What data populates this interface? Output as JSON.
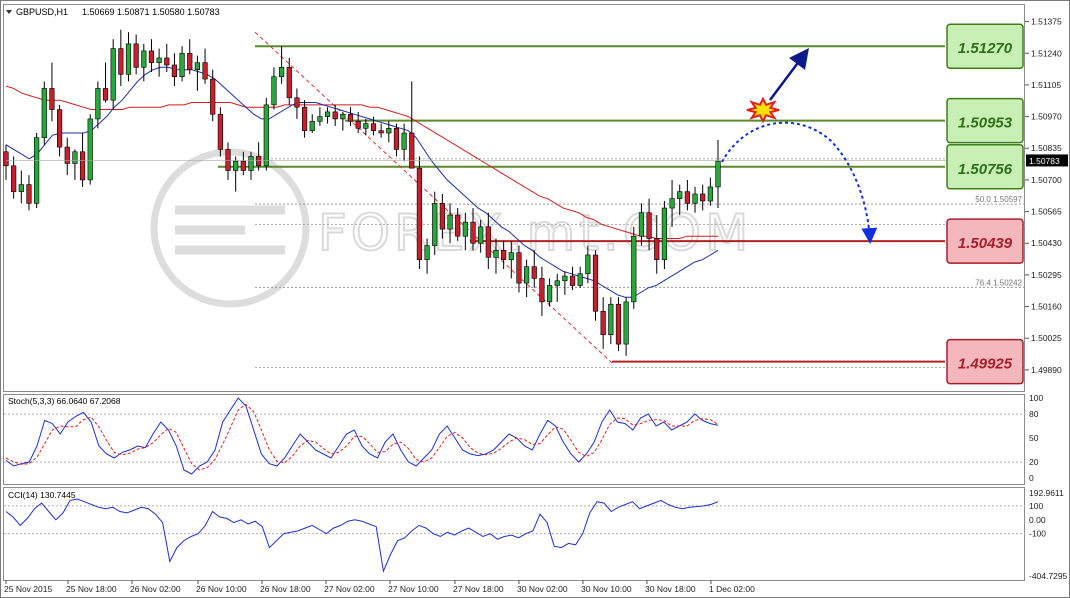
{
  "chart_data": [
    {
      "type": "candlestick",
      "symbol_label": "GBPUSD,H1",
      "ohlc_label": "1.50669 1.50871 1.50580 1.50783",
      "current_price": "1.50783",
      "ylim": [
        1.498,
        1.5145
      ],
      "price_ticks": [
        "1.51375",
        "1.51240",
        "1.51105",
        "1.50970",
        "1.50835",
        "1.50700",
        "1.50565",
        "1.50430",
        "1.50295",
        "1.50160",
        "1.50025",
        "1.49890"
      ],
      "time_ticks": [
        "25 Nov 2015",
        "25 Nov 18:00",
        "26 Nov 02:00",
        "26 Nov 10:00",
        "26 Nov 18:00",
        "27 Nov 02:00",
        "27 Nov 10:00",
        "27 Nov 18:00",
        "30 Nov 02:00",
        "30 Nov 10:00",
        "30 Nov 18:00",
        "1 Dec 02:00"
      ],
      "candles": [
        [
          1.5082,
          1.5085,
          1.507,
          1.5076
        ],
        [
          1.5076,
          1.508,
          1.5062,
          1.5065
        ],
        [
          1.5065,
          1.5074,
          1.506,
          1.5068
        ],
        [
          1.5068,
          1.5072,
          1.5057,
          1.506
        ],
        [
          1.506,
          1.509,
          1.5058,
          1.5088
        ],
        [
          1.5088,
          1.5112,
          1.5085,
          1.5109
        ],
        [
          1.5109,
          1.512,
          1.5095,
          1.51
        ],
        [
          1.51,
          1.5102,
          1.508,
          1.5084
        ],
        [
          1.5084,
          1.5088,
          1.5072,
          1.5077
        ],
        [
          1.5077,
          1.5083,
          1.507,
          1.5082
        ],
        [
          1.5082,
          1.509,
          1.5067,
          1.507
        ],
        [
          1.507,
          1.5098,
          1.5068,
          1.5096
        ],
        [
          1.5096,
          1.5112,
          1.5092,
          1.5109
        ],
        [
          1.5109,
          1.512,
          1.5103,
          1.5104
        ],
        [
          1.5104,
          1.513,
          1.51,
          1.5126
        ],
        [
          1.5126,
          1.5134,
          1.511,
          1.5115
        ],
        [
          1.5115,
          1.5133,
          1.5112,
          1.5128
        ],
        [
          1.5128,
          1.5132,
          1.5115,
          1.5118
        ],
        [
          1.5118,
          1.5128,
          1.5112,
          1.5125
        ],
        [
          1.5125,
          1.513,
          1.5116,
          1.512
        ],
        [
          1.512,
          1.5126,
          1.5114,
          1.5122
        ],
        [
          1.5122,
          1.5128,
          1.5116,
          1.5119
        ],
        [
          1.5119,
          1.5124,
          1.511,
          1.5114
        ],
        [
          1.5114,
          1.5127,
          1.5112,
          1.5124
        ],
        [
          1.5124,
          1.513,
          1.5115,
          1.5117
        ],
        [
          1.5117,
          1.5123,
          1.5108,
          1.512
        ],
        [
          1.512,
          1.5126,
          1.5111,
          1.5113
        ],
        [
          1.5113,
          1.5117,
          1.5095,
          1.5098
        ],
        [
          1.5098,
          1.5101,
          1.508,
          1.5083
        ],
        [
          1.5083,
          1.5086,
          1.507,
          1.5074
        ],
        [
          1.5074,
          1.508,
          1.5065,
          1.5078
        ],
        [
          1.5078,
          1.5082,
          1.5072,
          1.5074
        ],
        [
          1.5074,
          1.5082,
          1.507,
          1.508
        ],
        [
          1.508,
          1.5086,
          1.5074,
          1.5076
        ],
        [
          1.5076,
          1.5105,
          1.5074,
          1.5102
        ],
        [
          1.5102,
          1.5118,
          1.51,
          1.5114
        ],
        [
          1.5114,
          1.5127,
          1.5111,
          1.5118
        ],
        [
          1.5118,
          1.5122,
          1.5102,
          1.5105
        ],
        [
          1.5105,
          1.5109,
          1.5096,
          1.5101
        ],
        [
          1.5101,
          1.5104,
          1.5088,
          1.5091
        ],
        [
          1.5091,
          1.5098,
          1.509,
          1.5095
        ],
        [
          1.5095,
          1.5101,
          1.5093,
          1.5097
        ],
        [
          1.5097,
          1.5101,
          1.5094,
          1.5099
        ],
        [
          1.5099,
          1.5102,
          1.5093,
          1.5096
        ],
        [
          1.5096,
          1.5099,
          1.5091,
          1.5098
        ],
        [
          1.5098,
          1.5101,
          1.5093,
          1.5095
        ],
        [
          1.5095,
          1.5099,
          1.509,
          1.5092
        ],
        [
          1.5092,
          1.5096,
          1.5089,
          1.5094
        ],
        [
          1.5094,
          1.5097,
          1.5089,
          1.5091
        ],
        [
          1.5091,
          1.5094,
          1.5088,
          1.509
        ],
        [
          1.509,
          1.5095,
          1.5086,
          1.5092
        ],
        [
          1.5092,
          1.5094,
          1.508,
          1.5083
        ],
        [
          1.5083,
          1.5094,
          1.5078,
          1.509
        ],
        [
          1.509,
          1.5112,
          1.5076,
          1.5075
        ],
        [
          1.5075,
          1.508,
          1.5032,
          1.5036
        ],
        [
          1.5036,
          1.5045,
          1.503,
          1.5042
        ],
        [
          1.5042,
          1.5065,
          1.5038,
          1.506
        ],
        [
          1.506,
          1.5064,
          1.5045,
          1.5049
        ],
        [
          1.5049,
          1.506,
          1.5043,
          1.5055
        ],
        [
          1.5055,
          1.5058,
          1.5044,
          1.5046
        ],
        [
          1.5046,
          1.5056,
          1.504,
          1.5052
        ],
        [
          1.5052,
          1.5058,
          1.504,
          1.5043
        ],
        [
          1.5043,
          1.5053,
          1.5039,
          1.505
        ],
        [
          1.505,
          1.5056,
          1.5032,
          1.5037
        ],
        [
          1.5037,
          1.5045,
          1.503,
          1.504
        ],
        [
          1.504,
          1.5044,
          1.5032,
          1.5036
        ],
        [
          1.5036,
          1.5044,
          1.5028,
          1.5039
        ],
        [
          1.5039,
          1.5042,
          1.5022,
          1.5026
        ],
        [
          1.5026,
          1.5036,
          1.502,
          1.5033
        ],
        [
          1.5033,
          1.504,
          1.5024,
          1.5028
        ],
        [
          1.5028,
          1.5033,
          1.5012,
          1.5018
        ],
        [
          1.5018,
          1.5028,
          1.5016,
          1.5025
        ],
        [
          1.5025,
          1.503,
          1.5018,
          1.5027
        ],
        [
          1.5027,
          1.5031,
          1.5021,
          1.5029
        ],
        [
          1.5029,
          1.5033,
          1.5023,
          1.5025
        ],
        [
          1.5025,
          1.5033,
          1.5024,
          1.503
        ],
        [
          1.503,
          1.5042,
          1.5026,
          1.5038
        ],
        [
          1.5038,
          1.504,
          1.501,
          1.5014
        ],
        [
          1.5014,
          1.502,
          1.4998,
          1.5004
        ],
        [
          1.5004,
          1.502,
          1.5,
          1.5017
        ],
        [
          1.5017,
          1.502,
          1.4997,
          1.5
        ],
        [
          1.5,
          1.502,
          1.4995,
          1.5018
        ],
        [
          1.5018,
          1.505,
          1.5015,
          1.5046
        ],
        [
          1.5046,
          1.506,
          1.5042,
          1.5056
        ],
        [
          1.5056,
          1.5062,
          1.504,
          1.5045
        ],
        [
          1.5045,
          1.5055,
          1.503,
          1.5036
        ],
        [
          1.5036,
          1.5061,
          1.5032,
          1.5058
        ],
        [
          1.5058,
          1.507,
          1.505,
          1.5062
        ],
        [
          1.5062,
          1.5068,
          1.5055,
          1.5065
        ],
        [
          1.5065,
          1.507,
          1.5057,
          1.506
        ],
        [
          1.506,
          1.5067,
          1.5056,
          1.5064
        ],
        [
          1.5064,
          1.5068,
          1.5057,
          1.5061
        ],
        [
          1.5061,
          1.5071,
          1.5059,
          1.5067
        ],
        [
          1.5067,
          1.5087,
          1.5058,
          1.5078
        ]
      ],
      "ma_fast": [
        1.5085,
        1.5083,
        1.5081,
        1.5079,
        1.5081,
        1.5085,
        1.5089,
        1.509,
        1.509,
        1.509,
        1.509,
        1.5091,
        1.5094,
        1.5097,
        1.5101,
        1.5104,
        1.5108,
        1.5112,
        1.5115,
        1.5117,
        1.5118,
        1.5118,
        1.5117,
        1.5117,
        1.5117,
        1.5116,
        1.5115,
        1.5113,
        1.511,
        1.5107,
        1.5104,
        1.5101,
        1.5098,
        1.5096,
        1.5096,
        1.5098,
        1.51,
        1.5102,
        1.5103,
        1.5103,
        1.5103,
        1.5102,
        1.5101,
        1.51,
        1.5099,
        1.5098,
        1.5097,
        1.5096,
        1.5095,
        1.5094,
        1.5093,
        1.5092,
        1.5091,
        1.5088,
        1.5083,
        1.5078,
        1.5074,
        1.507,
        1.5067,
        1.5064,
        1.5061,
        1.5058,
        1.5056,
        1.5053,
        1.505,
        1.5048,
        1.5045,
        1.5042,
        1.504,
        1.5037,
        1.5035,
        1.5033,
        1.5031,
        1.503,
        1.5029,
        1.5028,
        1.5027,
        1.5025,
        1.5023,
        1.5021,
        1.502,
        1.502,
        1.5022,
        1.5024,
        1.5025,
        1.5027,
        1.5029,
        1.5031,
        1.5033,
        1.5035,
        1.5036,
        1.5038,
        1.504
      ],
      "ma_slow": [
        1.511,
        1.5109,
        1.5107,
        1.5106,
        1.5105,
        1.5104,
        1.5104,
        1.5104,
        1.5103,
        1.5102,
        1.5101,
        1.51,
        1.51,
        1.51,
        1.51,
        1.51,
        1.5101,
        1.5101,
        1.5101,
        1.5101,
        1.5101,
        1.5102,
        1.5102,
        1.5102,
        1.5103,
        1.5103,
        1.5103,
        1.5103,
        1.5103,
        1.5103,
        1.5102,
        1.5101,
        1.5101,
        1.5101,
        1.5101,
        1.5101,
        1.5102,
        1.5102,
        1.5102,
        1.5102,
        1.5102,
        1.5102,
        1.5102,
        1.5102,
        1.5102,
        1.5102,
        1.5102,
        1.5101,
        1.5101,
        1.51,
        1.5099,
        1.5098,
        1.5097,
        1.5095,
        1.5093,
        1.5091,
        1.5089,
        1.5087,
        1.5085,
        1.5083,
        1.5081,
        1.5079,
        1.5077,
        1.5075,
        1.5073,
        1.5071,
        1.5069,
        1.5067,
        1.5065,
        1.5063,
        1.5062,
        1.506,
        1.5058,
        1.5057,
        1.5056,
        1.5054,
        1.5053,
        1.5051,
        1.505,
        1.5049,
        1.5048,
        1.5047,
        1.5046,
        1.5046,
        1.5045,
        1.5045,
        1.5045,
        1.5045,
        1.5046,
        1.5046,
        1.5046,
        1.5046,
        1.5046
      ],
      "levels": [
        {
          "label": "1.51270",
          "value": 1.5127,
          "kind": "resistance"
        },
        {
          "label": "1.50953",
          "value": 1.50953,
          "kind": "resistance"
        },
        {
          "label": "1.50756",
          "value": 1.50756,
          "kind": "resistance"
        },
        {
          "label": "1.50439",
          "value": 1.50439,
          "kind": "support"
        },
        {
          "label": "1.49925",
          "value": 1.49925,
          "kind": "support"
        }
      ],
      "fibonacci": [
        {
          "text": "50.0  1.50597",
          "value": 1.50597
        },
        {
          "text": "76.4  1.50242",
          "value": 1.50242
        }
      ],
      "watermark": "FOREX.mt.COM"
    },
    {
      "type": "line",
      "title": "Stoch(5,3,3) 66.0640 67.2068",
      "ylim": [
        0,
        100
      ],
      "tick_labels": [
        "100",
        "80",
        "50",
        "20",
        "0"
      ],
      "tick_values": [
        100,
        80,
        50,
        20,
        0
      ],
      "main": [
        22,
        15,
        18,
        20,
        40,
        72,
        68,
        55,
        70,
        77,
        82,
        70,
        40,
        30,
        25,
        32,
        35,
        40,
        38,
        55,
        70,
        60,
        40,
        10,
        5,
        15,
        20,
        35,
        70,
        85,
        100,
        90,
        60,
        30,
        18,
        15,
        25,
        40,
        55,
        45,
        35,
        30,
        25,
        40,
        55,
        60,
        40,
        30,
        25,
        45,
        55,
        35,
        20,
        15,
        25,
        35,
        55,
        65,
        50,
        35,
        30,
        28,
        30,
        35,
        45,
        55,
        50,
        40,
        35,
        55,
        72,
        65,
        45,
        30,
        20,
        30,
        45,
        70,
        85,
        70,
        68,
        60,
        75,
        80,
        65,
        70,
        60,
        65,
        70,
        80,
        72,
        68,
        66
      ],
      "signal": [
        25,
        20,
        17,
        18,
        26,
        43,
        60,
        65,
        64,
        64,
        73,
        76,
        64,
        47,
        32,
        29,
        31,
        36,
        38,
        44,
        54,
        62,
        57,
        37,
        18,
        10,
        13,
        23,
        42,
        63,
        85,
        92,
        83,
        60,
        36,
        21,
        19,
        27,
        40,
        47,
        45,
        37,
        30,
        32,
        40,
        52,
        52,
        43,
        32,
        33,
        42,
        45,
        37,
        23,
        20,
        25,
        38,
        52,
        57,
        50,
        38,
        31,
        29,
        31,
        37,
        45,
        50,
        48,
        42,
        43,
        54,
        64,
        61,
        47,
        32,
        27,
        32,
        48,
        67,
        75,
        74,
        66,
        68,
        72,
        73,
        72,
        65,
        65,
        65,
        72,
        74,
        73,
        67
      ]
    },
    {
      "type": "line",
      "title": "CCI(14) 130.7445",
      "ylim": [
        -404.7295,
        192.9611
      ],
      "tick_labels": [
        "192.9611",
        "100",
        "0.00",
        "-100",
        "-404.7295"
      ],
      "tick_values": [
        192.9611,
        100,
        0,
        -100,
        -404.7295
      ],
      "values": [
        60,
        20,
        -40,
        10,
        80,
        120,
        60,
        0,
        50,
        140,
        150,
        130,
        110,
        90,
        80,
        90,
        60,
        50,
        70,
        90,
        80,
        40,
        -20,
        -300,
        -200,
        -150,
        -120,
        -100,
        -40,
        60,
        20,
        10,
        -20,
        0,
        -30,
        -10,
        -50,
        -200,
        -150,
        -100,
        -90,
        -80,
        -60,
        -40,
        -70,
        -100,
        -60,
        -40,
        -10,
        0,
        -10,
        -30,
        -50,
        -370,
        -250,
        -150,
        -130,
        -80,
        -40,
        -60,
        -100,
        -120,
        -90,
        -110,
        -80,
        -60,
        -90,
        -120,
        -100,
        -140,
        -120,
        -110,
        -130,
        -100,
        -80,
        40,
        -20,
        -190,
        -200,
        -170,
        -180,
        -100,
        50,
        130,
        120,
        60,
        90,
        110,
        130,
        80,
        100,
        120,
        140,
        110,
        90,
        80,
        90,
        95,
        100,
        110,
        130
      ]
    }
  ]
}
